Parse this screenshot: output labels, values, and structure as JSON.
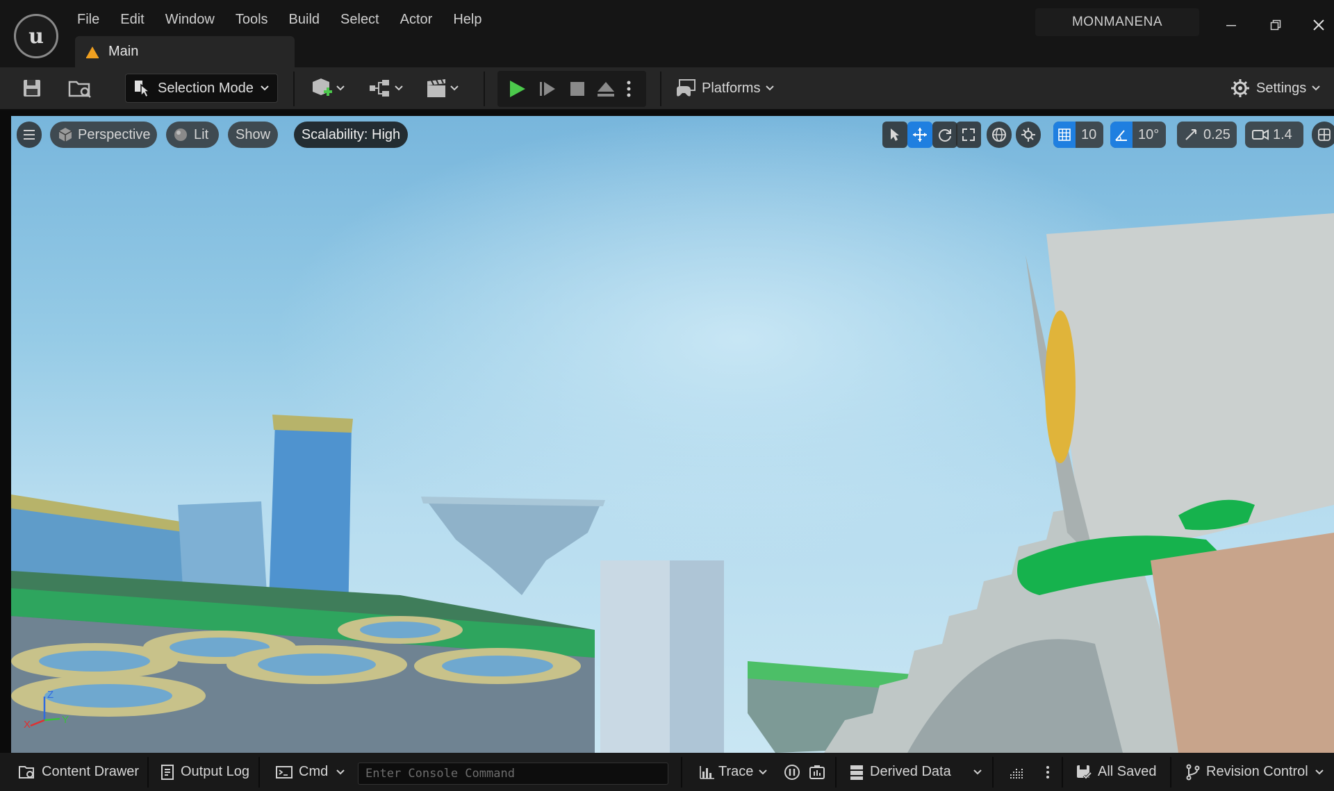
{
  "app": {
    "menu": [
      "File",
      "Edit",
      "Window",
      "Tools",
      "Build",
      "Select",
      "Actor",
      "Help"
    ],
    "tab_label": "Main",
    "project_name": "MONMANENA"
  },
  "toolbar": {
    "selection_mode_label": "Selection Mode",
    "platforms_label": "Platforms",
    "settings_label": "Settings"
  },
  "viewport": {
    "perspective_label": "Perspective",
    "lit_label": "Lit",
    "show_label": "Show",
    "scalability_label": "Scalability: High",
    "grid_snap_value": "10",
    "rotation_snap_value": "10°",
    "scale_snap_value": "0.25",
    "camera_speed_value": "1.4",
    "axis_labels": {
      "z": "Z",
      "x": "X",
      "y": "Y"
    }
  },
  "statusbar": {
    "content_drawer_label": "Content Drawer",
    "output_log_label": "Output Log",
    "cmd_label": "Cmd",
    "console_placeholder": "Enter Console Command",
    "trace_label": "Trace",
    "derived_data_label": "Derived Data",
    "all_saved_label": "All Saved",
    "revision_control_label": "Revision Control"
  },
  "colors": {
    "play_green": "#4cc94c",
    "active_blue": "#1f7fe0",
    "warning_orange": "#f0a020"
  }
}
